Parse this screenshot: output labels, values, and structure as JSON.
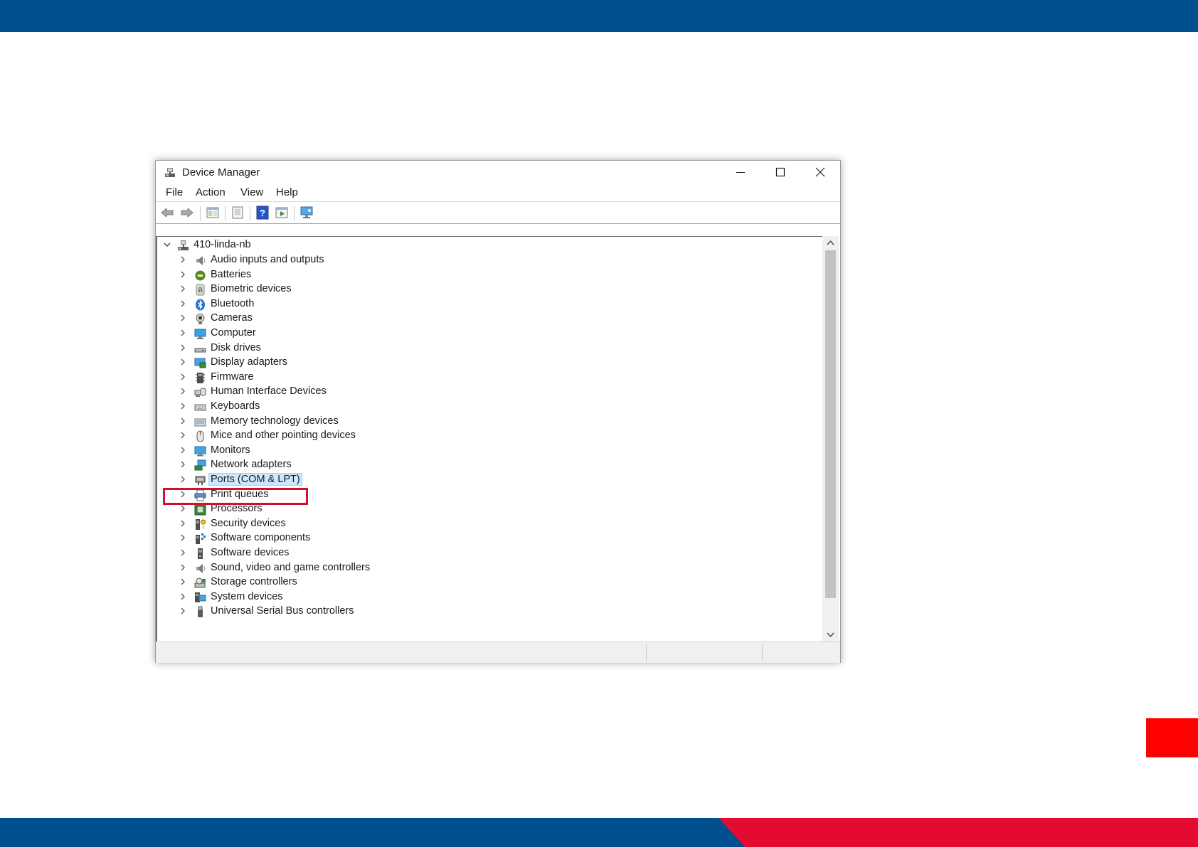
{
  "window": {
    "title": "Device Manager",
    "menu": [
      "File",
      "Action",
      "View",
      "Help"
    ]
  },
  "tree": {
    "root": "410-linda-nb",
    "items": [
      {
        "label": "Audio inputs and outputs",
        "icon": "speaker-icon"
      },
      {
        "label": "Batteries",
        "icon": "battery-icon"
      },
      {
        "label": "Biometric devices",
        "icon": "fingerprint-icon"
      },
      {
        "label": "Bluetooth",
        "icon": "bluetooth-icon"
      },
      {
        "label": "Cameras",
        "icon": "camera-icon"
      },
      {
        "label": "Computer",
        "icon": "computer-icon"
      },
      {
        "label": "Disk drives",
        "icon": "disk-drive-icon"
      },
      {
        "label": "Display adapters",
        "icon": "display-adapter-icon"
      },
      {
        "label": "Firmware",
        "icon": "firmware-chip-icon"
      },
      {
        "label": "Human Interface Devices",
        "icon": "hid-icon"
      },
      {
        "label": "Keyboards",
        "icon": "keyboard-icon"
      },
      {
        "label": "Memory technology devices",
        "icon": "memory-card-icon"
      },
      {
        "label": "Mice and other pointing devices",
        "icon": "mouse-icon"
      },
      {
        "label": "Monitors",
        "icon": "monitor-icon"
      },
      {
        "label": "Network adapters",
        "icon": "network-adapter-icon"
      },
      {
        "label": "Ports (COM & LPT)",
        "icon": "port-icon",
        "selected": true
      },
      {
        "label": "Print queues",
        "icon": "printer-icon"
      },
      {
        "label": "Processors",
        "icon": "processor-icon"
      },
      {
        "label": "Security devices",
        "icon": "security-key-icon"
      },
      {
        "label": "Software components",
        "icon": "software-component-icon"
      },
      {
        "label": "Software devices",
        "icon": "software-device-icon"
      },
      {
        "label": "Sound, video and game controllers",
        "icon": "sound-icon"
      },
      {
        "label": "Storage controllers",
        "icon": "storage-controller-icon"
      },
      {
        "label": "System devices",
        "icon": "system-devices-icon"
      },
      {
        "label": "Universal Serial Bus controllers",
        "icon": "usb-icon"
      }
    ]
  },
  "colors": {
    "band_blue": "#00508f",
    "band_red": "#e30b2f",
    "highlight_box": "#d0102e",
    "selection": "#cce8ff"
  }
}
